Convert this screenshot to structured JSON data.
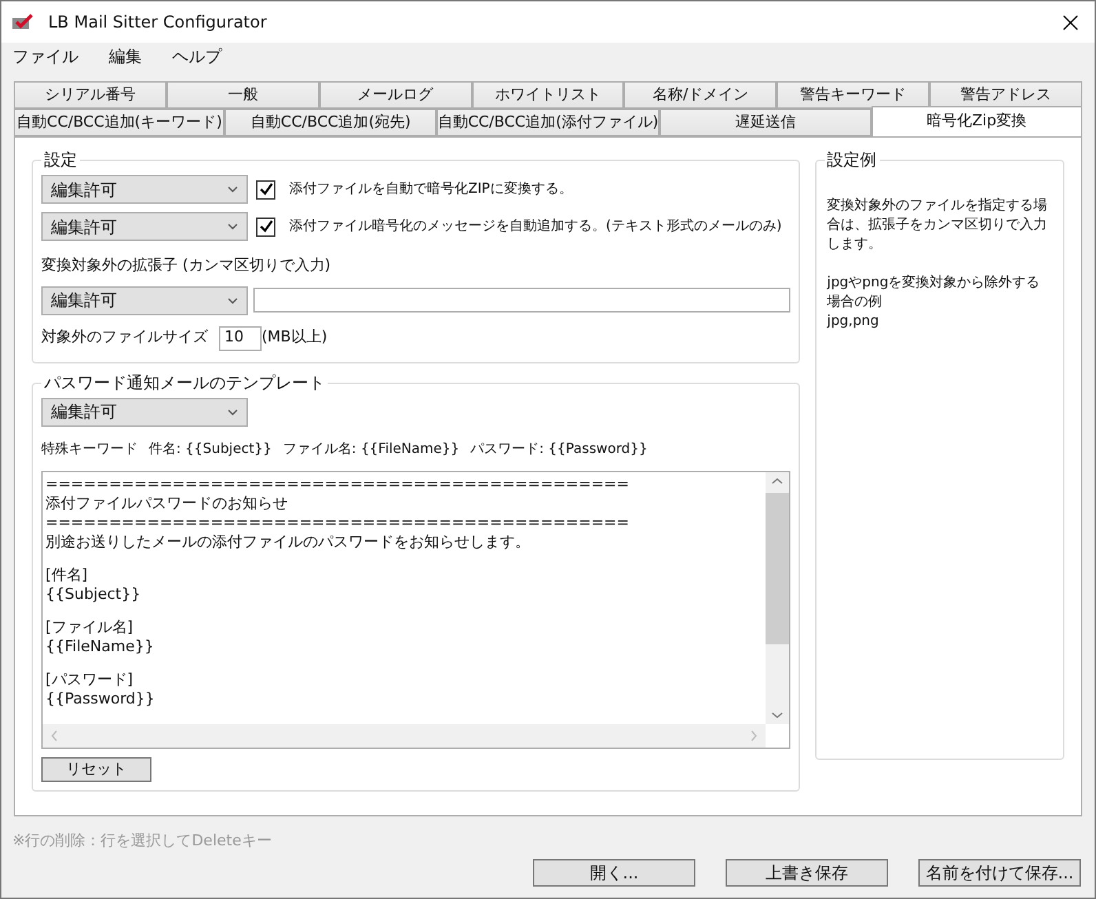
{
  "window": {
    "title": "LB Mail Sitter Configurator"
  },
  "menu": [
    "ファイル",
    "編集",
    "ヘルプ"
  ],
  "tab_rows": [
    [
      {
        "label": "シリアル番号",
        "selected": false
      },
      {
        "label": "一般",
        "selected": false
      },
      {
        "label": "メールログ",
        "selected": false
      },
      {
        "label": "ホワイトリスト",
        "selected": false
      },
      {
        "label": "名称/ドメイン",
        "selected": false
      },
      {
        "label": "警告キーワード",
        "selected": false
      },
      {
        "label": "警告アドレス",
        "selected": false
      }
    ],
    [
      {
        "label": "自動CC/BCC追加(キーワード)",
        "selected": false
      },
      {
        "label": "自動CC/BCC追加(宛先)",
        "selected": false
      },
      {
        "label": "自動CC/BCC追加(添付ファイル)",
        "selected": false
      },
      {
        "label": "遅延送信",
        "selected": false
      },
      {
        "label": "暗号化Zip変換",
        "selected": true
      }
    ]
  ],
  "settings": {
    "title": "設定",
    "options": [
      {
        "permission": "編集許可",
        "checked": true,
        "label": "添付ファイルを自動で暗号化ZIPに変換する。"
      },
      {
        "permission": "編集許可",
        "checked": true,
        "label": "添付ファイル暗号化のメッセージを自動追加する。(テキスト形式のメールのみ)"
      }
    ],
    "extensions_label": "変換対象外の拡張子 (カンマ区切りで入力)",
    "extensions_permission": "編集許可",
    "size_label": "対象外のファイルサイズ",
    "size_value": "10",
    "size_unit": "(MB以上)"
  },
  "template": {
    "title": "パスワード通知メールのテンプレート",
    "permission": "編集許可",
    "keywords": [
      "特殊キーワード",
      "件名: {{Subject}}",
      "ファイル名: {{FileName}}",
      "パスワード: {{Password}}"
    ],
    "paragraphs": [
      [
        "==============================================",
        "添付ファイルパスワードのお知らせ",
        "==============================================",
        "別途お送りしたメールの添付ファイルのパスワードをお知らせします。"
      ],
      [
        "[件名]",
        "{{Subject}}"
      ],
      [
        "[ファイル名]",
        "{{FileName}}"
      ],
      [
        "[パスワード]",
        "{{Password}}"
      ]
    ],
    "reset_button": "リセット"
  },
  "example": {
    "title": "設定例",
    "paragraphs": [
      "変換対象外のファイルを指定する場合は、拡張子をカンマ区切りで入力します。",
      "jpgやpngを変換対象から除外する場合の例\njpg,png"
    ]
  },
  "hint": "※行の削除：行を選択してDeleteキー",
  "buttons": [
    "開く...",
    "上書き保存",
    "名前を付けて保存..."
  ]
}
